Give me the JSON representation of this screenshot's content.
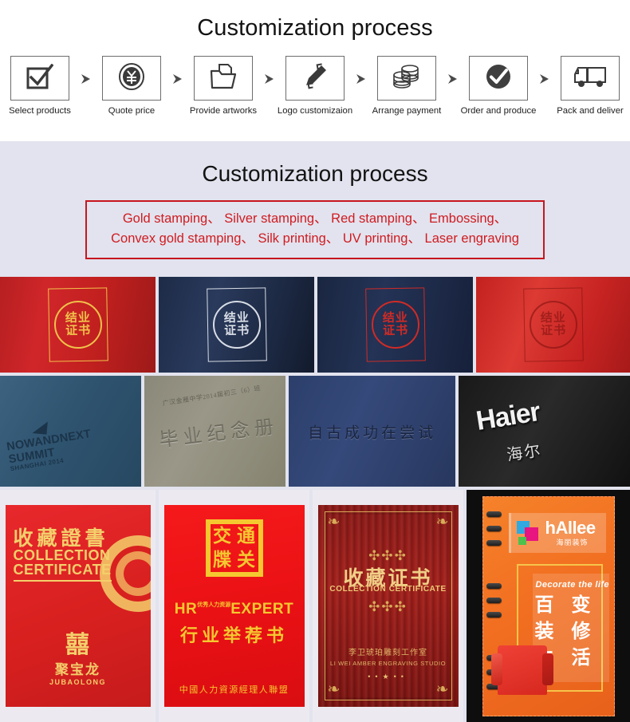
{
  "process": {
    "title": "Customization process",
    "steps": [
      {
        "label": "Select products",
        "icon": "checkbox-check-icon"
      },
      {
        "label": "Quote price",
        "icon": "yen-coin-icon"
      },
      {
        "label": "Provide artworks",
        "icon": "folder-file-icon"
      },
      {
        "label": "Logo customizaion",
        "icon": "pen-customize-icon"
      },
      {
        "label": "Arrange payment",
        "icon": "coin-stack-icon"
      },
      {
        "label": "Order and produce",
        "icon": "check-circle-icon"
      },
      {
        "label": "Pack and deliver",
        "icon": "delivery-truck-icon"
      }
    ],
    "arrow_icon": "arrow-right-icon"
  },
  "customization": {
    "title": "Customization process",
    "box_border_color": "#c7161d",
    "text_color": "#d01b20",
    "background_color": "#e2e3ee",
    "lines": [
      "Gold stamping、 Silver stamping、 Red stamping、 Embossing、",
      "Convex gold stamping、 Silk printing、 UV printing、 Laser engraving"
    ],
    "methods": [
      "Gold stamping",
      "Silver stamping",
      "Red stamping",
      "Embossing",
      "Convex gold stamping",
      "Silk printing",
      "UV printing",
      "Laser engraving"
    ]
  },
  "gallery": {
    "rows": [
      {
        "name": "row-certificate-covers",
        "cells": [
          {
            "name": "red-gold-stamped-certificate",
            "technique": "Gold stamping",
            "text_cn": "结业\n证书",
            "line1": "结业",
            "line2": "证书"
          },
          {
            "name": "navy-silver-stamped-certificate",
            "technique": "Silver stamping",
            "line1": "结业",
            "line2": "证书"
          },
          {
            "name": "navy-red-stamped-certificate",
            "technique": "Red stamping",
            "line1": "结业",
            "line2": "证书"
          },
          {
            "name": "red-embossed-certificate",
            "technique": "Embossing",
            "line1": "结业",
            "line2": "证书"
          }
        ]
      },
      {
        "name": "row-logo-covers",
        "cells": [
          {
            "name": "nowandnext-summit-cover",
            "line1": "NOWANDNEXT",
            "line2": "SUMMIT",
            "line3": "SHANGHAI 2014"
          },
          {
            "name": "grey-embossed-yearbook",
            "small_text": "广汉金雁中学2014届初三（6）班",
            "big_text": "毕业纪念册"
          },
          {
            "name": "blue-debossed-quote-cover",
            "text": "自古成功在尝试"
          },
          {
            "name": "black-haier-embossed-cover",
            "brand_en": "Haier",
            "brand_cn": "海尔"
          }
        ]
      },
      {
        "name": "row-printed-covers",
        "cells": [
          {
            "name": "collection-certificate-red-cover",
            "title_cn": "收藏證書",
            "title_en_line1": "COLLECTION",
            "title_en_line2": "CERTIFICATE",
            "logo_symbol": "囍",
            "brand_cn": "聚宝龙",
            "brand_en": "JUBAOLONG"
          },
          {
            "name": "hr-expert-recommendation-cover",
            "seal_chars": [
              "交",
              "通",
              "牒",
              "关"
            ],
            "logo_main": "HR",
            "logo_small": "优秀人力资源",
            "logo_sub": "EXPERT",
            "title_cn": "行业举荐书",
            "footer_cn": "中國人力資源經理人聯盟"
          },
          {
            "name": "wood-grain-collection-certificate",
            "title_cn": "收藏证书",
            "title_en": "COLLECTION CERTIFICATE",
            "studio_cn": "李卫琥珀雕刻工作室",
            "studio_en": "LI WEI AMBER ENGRAVING STUDIO",
            "ornament": "❧"
          },
          {
            "name": "hallee-orange-notebook-cover",
            "brand": "hAllee",
            "brand_cn": "海丽装饰",
            "tagline_en": "Decorate the life",
            "tagline_cn_line1": "百 变",
            "tagline_cn_line2": "装 修",
            "tagline_cn_line3": "生 活"
          }
        ]
      }
    ]
  }
}
